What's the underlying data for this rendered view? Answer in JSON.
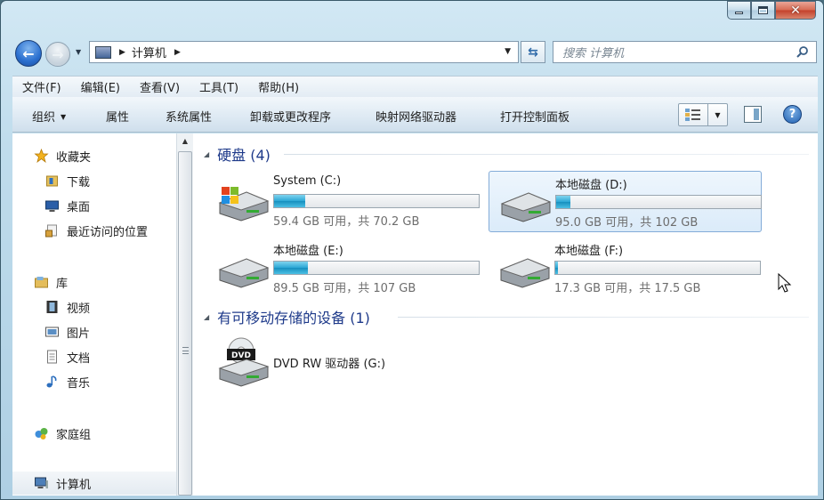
{
  "window": {
    "caption": {
      "minimize": "minimize",
      "maximize": "maximize",
      "close": "✕"
    }
  },
  "nav": {
    "address_path": "计算机",
    "search_placeholder": "搜索 计算机"
  },
  "menubar": {
    "items": [
      "文件(F)",
      "编辑(E)",
      "查看(V)",
      "工具(T)",
      "帮助(H)"
    ]
  },
  "commandbar": {
    "organize": "组织",
    "properties": "属性",
    "system_properties": "系统属性",
    "uninstall": "卸载或更改程序",
    "map_drive": "映射网络驱动器",
    "control_panel": "打开控制面板"
  },
  "navpane": {
    "favorites": "收藏夹",
    "downloads": "下载",
    "desktop": "桌面",
    "recent": "最近访问的位置",
    "libraries": "库",
    "videos": "视频",
    "pictures": "图片",
    "documents": "文档",
    "music": "音乐",
    "homegroup": "家庭组",
    "computer": "计算机"
  },
  "content": {
    "hard_disks_header": "硬盘 (4)",
    "removable_header": "有可移动存储的设备 (1)",
    "drives": [
      {
        "name": "System (C:)",
        "free_text": "59.4 GB 可用，共 70.2 GB",
        "used_fraction": 0.154
      },
      {
        "name": "本地磁盘 (D:)",
        "free_text": "95.0 GB 可用，共 102 GB",
        "used_fraction": 0.069
      },
      {
        "name": "本地磁盘 (E:)",
        "free_text": "89.5 GB 可用，共 107 GB",
        "used_fraction": 0.164
      },
      {
        "name": "本地磁盘 (F:)",
        "free_text": "17.3 GB 可用，共 17.5 GB",
        "used_fraction": 0.011
      }
    ],
    "dvd": {
      "name": "DVD RW 驱动器 (G:)",
      "badge": "DVD"
    }
  },
  "colors": {
    "accent": "#1e3a8a",
    "bar_fill": "#2aa7d5"
  }
}
